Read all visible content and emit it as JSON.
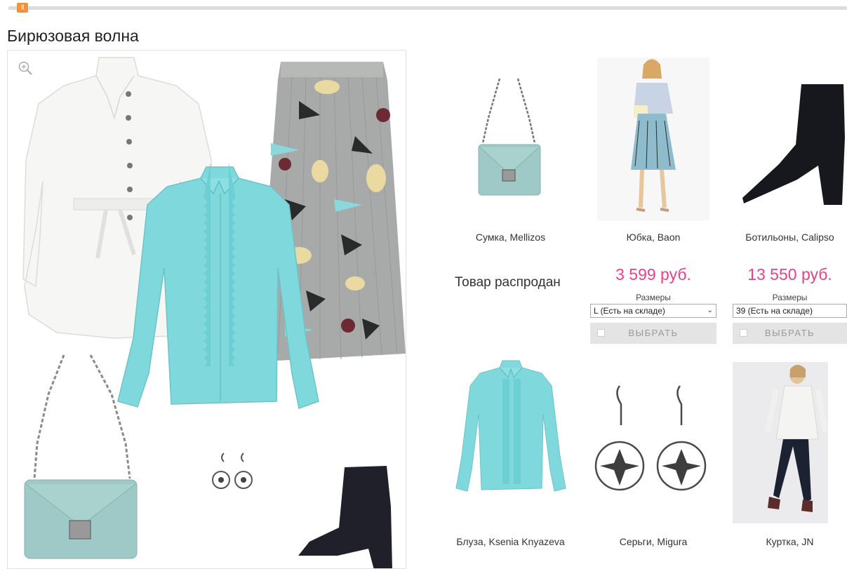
{
  "slider": {
    "thumb_glyph": "|||"
  },
  "set": {
    "title": "Бирюзовая волна"
  },
  "collage": {
    "zoom_icon": "zoom-in-icon"
  },
  "products": [
    {
      "id": "bag",
      "name": "Сумка, Mellizos",
      "status": "Товар распродан"
    },
    {
      "id": "skirt",
      "name": "Юбка, Baon",
      "price": "3 599 руб.",
      "sizes_label": "Размеры",
      "size_value": "L (Есть на складе)",
      "button": "ВЫБРАТЬ"
    },
    {
      "id": "boots",
      "name": "Ботильоны, Calipso",
      "price": "13 550 руб.",
      "sizes_label": "Размеры",
      "size_value": "39 (Есть на складе)",
      "button": "ВЫБРАТЬ"
    },
    {
      "id": "blouse",
      "name": "Блуза, Ksenia Knyazeva"
    },
    {
      "id": "earrings",
      "name": "Серьги, Migura"
    },
    {
      "id": "jacket",
      "name": "Куртка, JN"
    }
  ],
  "colors": {
    "accent_price": "#ef3f8a",
    "slider_thumb": "#f2913a",
    "turquoise": "#7fd8dc",
    "bag_mint": "#9fc9c6"
  }
}
